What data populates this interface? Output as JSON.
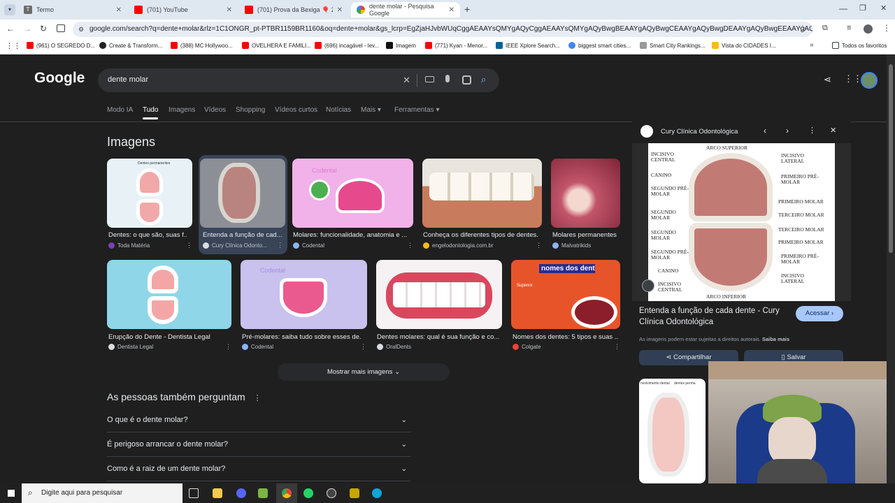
{
  "browser": {
    "tabs": [
      {
        "title": "Termo",
        "active": false,
        "icon": "termo-icon"
      },
      {
        "title": "(701) YouTube",
        "active": false,
        "icon": "youtube-icon"
      },
      {
        "title": "(701) Prova da Bexiga 🎈 2 - Yo",
        "active": false,
        "icon": "youtube-icon"
      },
      {
        "title": "dente molar - Pesquisa Google",
        "active": true,
        "icon": "google-icon"
      }
    ],
    "url": "google.com/search?q=dente+molar&rlz=1C1ONGR_pt-PTBR1159BR1160&oq=dente+molar&gs_lcrp=EgZjaHJvbWUqCggAEAAYsQMYgAQyCggAEAAYsQMYgAQyBwgBEAAYgAQyBwgCEAAYgAQyBwgDEAAYgAQyBwgEEAAYgAQyBwgFEAAYgAQ...",
    "bookmarks": [
      "(961) O SEGREDO D...",
      "Create & Transform...",
      "(388) MC Hollywoo...",
      "OVELHERA E FAMILI...",
      "(696) incagável - lev...",
      "Imagem",
      "(771) Kyan - Menor...",
      "IEEE Xplore Search...",
      "biggest smart cities...",
      "Smart City Rankings...",
      "Vista do CIDADES I..."
    ],
    "all_bookmarks": "Todos os favoritos"
  },
  "google": {
    "logo": "Google",
    "query": "dente molar",
    "nav": [
      "Modo IA",
      "Tudo",
      "Imagens",
      "Vídeos",
      "Shopping",
      "Vídeos curtos",
      "Notícias",
      "Mais",
      "Ferramentas"
    ],
    "images_heading": "Imagens",
    "images_row1": [
      {
        "caption": "Dentes: o que são, suas f...",
        "source": "Toda Matéria"
      },
      {
        "caption": "Entenda a função de cad...",
        "source": "Cury Clínica Odonto..."
      },
      {
        "caption": "Molares: funcionalidade, anatomia e ...",
        "source": "Codental"
      },
      {
        "caption": "Conheça os diferentes tipos de dentes...",
        "source": "engelodontologia.com.br"
      },
      {
        "caption": "Molares permanentes",
        "source": "Malvatrikids"
      }
    ],
    "images_row2": [
      {
        "caption": "Erupção do Dente - Dentista Legal",
        "source": "Dentista Legal"
      },
      {
        "caption": "Pré-molares: saiba tudo sobre esses de...",
        "source": "Codental"
      },
      {
        "caption": "Dentes molares: qual é sua função e co...",
        "source": "OralDents"
      },
      {
        "caption": "Nomes dos dentes: 5 tipos e suas ...",
        "source": "Colgate"
      }
    ],
    "thumb_text": {
      "dentes_permanentes": "Dentes permanentes",
      "codental": "Codental",
      "nomes_dos_dentes": "nomes dos dentes",
      "superior": "Superior"
    },
    "more_images": "Mostrar mais imagens",
    "paa_heading": "As pessoas também perguntam",
    "paa": [
      "O que é o dente molar?",
      "É perigoso arrancar o dente molar?",
      "Como é a raiz de um dente molar?"
    ]
  },
  "preview": {
    "site": "Cury Clínica Odontológica",
    "title": "Entenda a função de cada dente - Cury Clínica Odontológica",
    "visit": "Acessar",
    "notice": "As imagens podem estar sujeitas a direitos autorais.",
    "learn_more": "Saiba mais",
    "share": "Compartilhar",
    "save": "Salvar",
    "diagram_labels": {
      "top": "ARCO SUPERIOR",
      "bottom": "ARCO INFERIOR",
      "left": [
        "INCISIVO CENTRAL",
        "CANINO",
        "SEGUNDO PRÉ-MOLAR",
        "SEGUNDO MOLAR",
        "SEGUNDO MOLAR",
        "SEGUNDO PRÉ-MOLAR",
        "CANINO",
        "INCISIVO CENTRAL"
      ],
      "right": [
        "INCISIVO LATERAL",
        "PRIMEIRO PRÉ-MOLAR",
        "PRIMEIRO MOLAR",
        "TERCEIRO MOLAR",
        "TERCEIRO MOLAR",
        "PRIMEIRO MOLAR",
        "PRIMEIRO PRÉ-MOLAR",
        "INCISIVO LATERAL"
      ]
    },
    "thumb_label": "nvolvimento dental",
    "thumb_label2": "dentes perma"
  },
  "taskbar": {
    "search_placeholder": "Digite aqui para pesquisar"
  }
}
